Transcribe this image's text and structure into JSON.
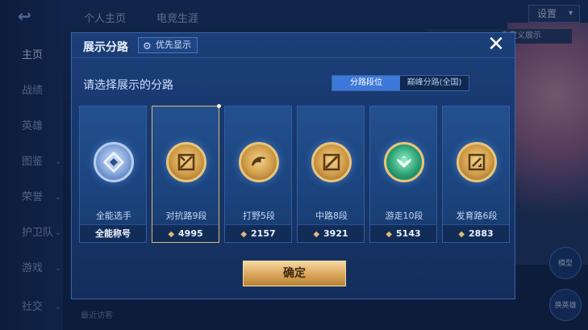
{
  "background": {
    "nav": [
      {
        "label": "主页",
        "active": true
      },
      {
        "label": "战绩"
      },
      {
        "label": "英雄"
      },
      {
        "label": "图鉴"
      },
      {
        "label": "荣誉"
      },
      {
        "label": "护卫队"
      },
      {
        "label": "游戏"
      },
      {
        "label": "社交"
      }
    ],
    "tabs": [
      "个人主页",
      "电竞生涯"
    ],
    "settings_label": "设置",
    "banner_text": "自定义展示",
    "bottom_text": "最近访客",
    "side_buttons": [
      "模型",
      "换英雄"
    ]
  },
  "modal": {
    "title": "展示分路",
    "priority_label": "优先显示",
    "prompt": "请选择展示的分路",
    "toggle": {
      "active": "分路段位",
      "inactive": "巅峰分路(全国)"
    },
    "cards": [
      {
        "name": "全能选手",
        "footer": "全能称号",
        "badge": "silver",
        "icon": "allround-icon",
        "selected": false
      },
      {
        "name": "对抗路9段",
        "score": "4995",
        "badge": "gold",
        "icon": "clash-lane-icon",
        "selected": true
      },
      {
        "name": "打野5段",
        "score": "2157",
        "badge": "gold",
        "icon": "jungle-icon",
        "selected": false
      },
      {
        "name": "中路8段",
        "score": "3921",
        "badge": "gold",
        "icon": "mid-lane-icon",
        "selected": false
      },
      {
        "name": "游走10段",
        "score": "5143",
        "badge": "green",
        "icon": "roam-icon",
        "selected": false
      },
      {
        "name": "发育路6段",
        "score": "2883",
        "badge": "gold",
        "icon": "farm-lane-icon",
        "selected": false
      }
    ],
    "confirm_label": "确定"
  },
  "colors": {
    "accent": "#3d79d8",
    "gold": "#e0b878",
    "panel": "#173669"
  }
}
